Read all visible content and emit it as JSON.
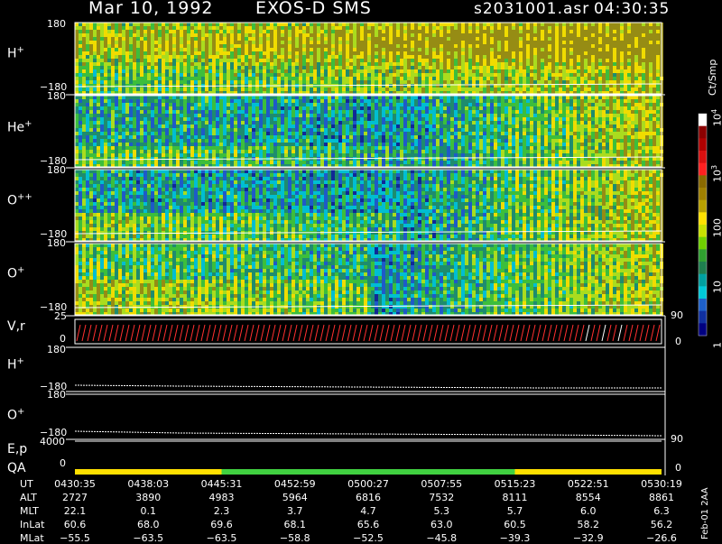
{
  "header": {
    "title_left": "Mar 10, 1992",
    "title_mid": "EXOS-D SMS",
    "file_id": "s2031001.asr",
    "time": "04:30:35"
  },
  "panels": {
    "spectrograms": [
      {
        "label": "H",
        "sup": "+",
        "top_tick": "180",
        "bottom_tick": "−180"
      },
      {
        "label": "He",
        "sup": "+",
        "top_tick": "180",
        "bottom_tick": "−180"
      },
      {
        "label": "O",
        "sup": "++",
        "top_tick": "180",
        "bottom_tick": "−180"
      },
      {
        "label": "O",
        "sup": "+",
        "top_tick": "180",
        "bottom_tick": "−180"
      }
    ],
    "vr": {
      "label": "V,r",
      "left_top": "25",
      "left_bottom": "0",
      "right_top": "90",
      "right_bottom": "0"
    },
    "h_line": {
      "label": "H",
      "sup": "+",
      "top_tick": "180",
      "bottom_tick": "−180"
    },
    "o_line": {
      "label": "O",
      "sup": "+",
      "top_tick": "180",
      "bottom_tick": "−180"
    },
    "ep": {
      "label": "E,p",
      "left_tick": "4000",
      "right_tick": "90"
    },
    "qa": {
      "label": "QA",
      "left_tick": "0",
      "right_tick": "0"
    }
  },
  "colorbar": {
    "unit": "Ct/Smp",
    "ticks": [
      {
        "base": "10",
        "exp": "4",
        "frac": 0.0
      },
      {
        "base": "10",
        "exp": "3",
        "frac": 0.25
      },
      {
        "base": "100",
        "exp": "",
        "frac": 0.5
      },
      {
        "base": "10",
        "exp": "",
        "frac": 0.75
      },
      {
        "base": "1",
        "exp": "",
        "frac": 1.0
      }
    ],
    "colors": [
      "#ffffff",
      "#8b0000",
      "#b00000",
      "#d81010",
      "#ff2020",
      "#8a6a00",
      "#a08000",
      "#b8a000",
      "#ffe000",
      "#c8e000",
      "#70d000",
      "#30a030",
      "#1f7f4f",
      "#00a0a0",
      "#00c8d8",
      "#1e60c8",
      "#1030a0",
      "#000080"
    ]
  },
  "footer": {
    "rows": [
      {
        "name": "UT",
        "values": [
          "0430:35",
          "0438:03",
          "0445:31",
          "0452:59",
          "0500:27",
          "0507:55",
          "0515:23",
          "0522:51",
          "0530:19"
        ]
      },
      {
        "name": "ALT",
        "values": [
          "2727",
          "3890",
          "4983",
          "5964",
          "6816",
          "7532",
          "8111",
          "8554",
          "8861"
        ]
      },
      {
        "name": "MLT",
        "values": [
          "22.1",
          "0.1",
          "2.3",
          "3.7",
          "4.7",
          "5.3",
          "5.7",
          "6.0",
          "6.3"
        ]
      },
      {
        "name": "InLat",
        "values": [
          "60.6",
          "68.0",
          "69.6",
          "68.1",
          "65.6",
          "63.0",
          "60.5",
          "58.2",
          "56.2"
        ]
      },
      {
        "name": "MLat",
        "values": [
          "−55.5",
          "−63.5",
          "−63.5",
          "−58.8",
          "−52.5",
          "−45.8",
          "−39.3",
          "−32.9",
          "−26.6"
        ]
      }
    ],
    "stamp": "Feb-01 2AA"
  },
  "chart_data": {
    "type": "heatmap",
    "title": "Mar 10, 1992   EXOS-D SMS",
    "x_axis": "UT",
    "x_ticks": [
      "0430:35",
      "0438:03",
      "0445:31",
      "0452:59",
      "0500:27",
      "0507:55",
      "0515:23",
      "0522:51",
      "0530:19"
    ],
    "panels": [
      {
        "name": "H+",
        "ylim": [
          -180,
          180
        ]
      },
      {
        "name": "He+",
        "ylim": [
          -180,
          180
        ]
      },
      {
        "name": "O++",
        "ylim": [
          -180,
          180
        ]
      },
      {
        "name": "O+",
        "ylim": [
          -180,
          180
        ]
      },
      {
        "name": "V,r",
        "ylim": [
          0,
          25
        ],
        "y2lim": [
          0,
          90
        ]
      },
      {
        "name": "H+ (line)",
        "ylim": [
          -180,
          180
        ]
      },
      {
        "name": "O+ (line)",
        "ylim": [
          -180,
          180
        ]
      },
      {
        "name": "E,p",
        "ylim": [
          0,
          4000
        ],
        "y2lim": [
          0,
          90
        ]
      },
      {
        "name": "QA",
        "ylim": [
          0,
          0
        ]
      }
    ],
    "colorbar_unit": "Ct/Smp",
    "colorbar_range": [
      1,
      10000
    ],
    "colorbar_scale": "log",
    "qa_segments": [
      {
        "from": "0430:35",
        "to": "0445:31",
        "color": "#ffe000"
      },
      {
        "from": "0445:31",
        "to": "0515:23",
        "color": "#40d040"
      },
      {
        "from": "0515:23",
        "to": "0530:19",
        "color": "#ffe000"
      }
    ]
  }
}
